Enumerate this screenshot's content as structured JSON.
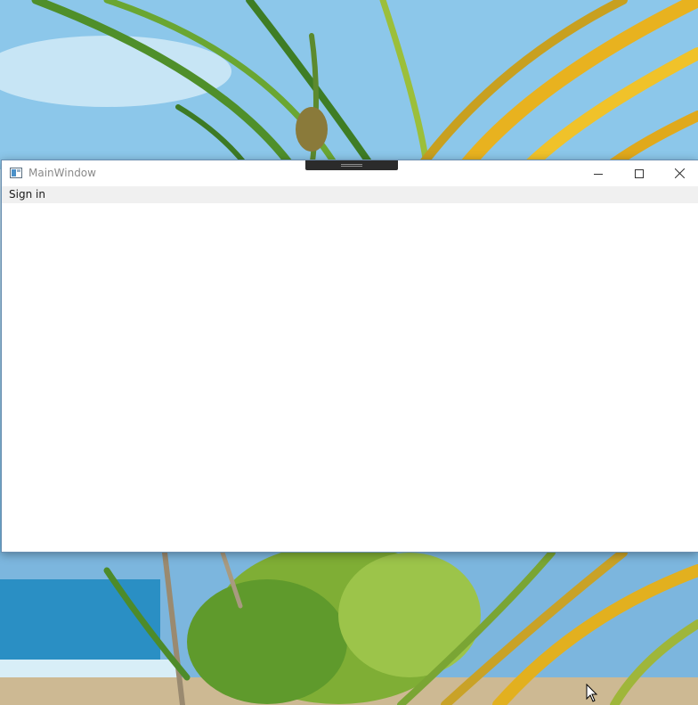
{
  "window": {
    "title": "MainWindow",
    "icon": "app-window-icon",
    "caption_buttons": [
      "minimize-icon",
      "maximize-icon",
      "close-icon"
    ]
  },
  "menu": {
    "items": [
      {
        "label": "Sign in"
      }
    ]
  },
  "desktop": {
    "wallpaper": "tropical-beach-palm-trees"
  },
  "colors": {
    "titlebar_bg": "#ffffff",
    "menubar_bg": "#f0f0f0",
    "window_border": "#6a8fb1",
    "title_text": "#8a8a8a"
  }
}
